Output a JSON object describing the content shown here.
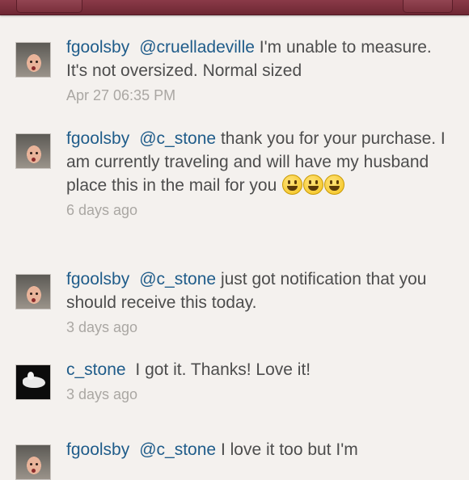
{
  "comments": [
    {
      "user": "fgoolsby",
      "mention": "@cruelladeville",
      "text": "I'm unable to measure. It's not oversized. Normal sized",
      "time": "Apr 27 06:35 PM",
      "avatar": "child-photo-avatar"
    },
    {
      "user": "fgoolsby",
      "mention": "@c_stone",
      "text": "thank you for your purchase. I am currently traveling and will have my husband place this in the mail for you",
      "emojis": [
        "smile-emoji",
        "grin-emoji",
        "smile-emoji"
      ],
      "time": "6 days ago",
      "avatar": "child-photo-avatar"
    },
    {
      "user": "fgoolsby",
      "mention": "@c_stone",
      "text": "just got notification that you should receive this today.",
      "time": "3 days ago",
      "avatar": "child-photo-avatar"
    },
    {
      "user": "c_stone",
      "mention": "",
      "text": "I got it. Thanks! Love it!",
      "time": "3 days ago",
      "avatar": "dark-photo-avatar"
    },
    {
      "user": "fgoolsby",
      "mention": "@c_stone",
      "text": "I love it too but I'm",
      "time": "",
      "avatar": "child-photo-avatar"
    }
  ]
}
